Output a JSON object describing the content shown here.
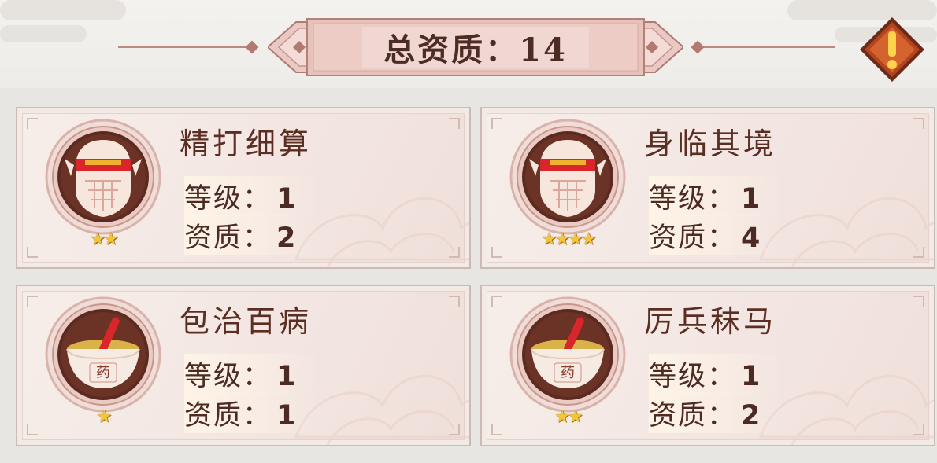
{
  "header": {
    "title": "总资质：14",
    "warning_icon": "exclamation-icon"
  },
  "colors": {
    "title_text": "#4e2c26",
    "card_bg": "#f3e6e2",
    "medallion_ring": "#5a2a20",
    "star": "#f2c53b",
    "accent_red": "#d8262a"
  },
  "skills": [
    {
      "name": "精打细算",
      "level_label": "等级：",
      "level": "1",
      "quality_label": "资质：",
      "quality": "2",
      "stars": "★★",
      "icon": "masked-face-icon"
    },
    {
      "name": "身临其境",
      "level_label": "等级：",
      "level": "1",
      "quality_label": "资质：",
      "quality": "4",
      "stars": "★★★★",
      "icon": "masked-face-icon"
    },
    {
      "name": "包治百病",
      "level_label": "等级：",
      "level": "1",
      "quality_label": "资质：",
      "quality": "1",
      "stars": "★",
      "icon": "medicine-bowl-icon",
      "bowl_text": "药"
    },
    {
      "name": "厉兵秣马",
      "level_label": "等级：",
      "level": "1",
      "quality_label": "资质：",
      "quality": "2",
      "stars": "★★",
      "icon": "medicine-bowl-icon",
      "bowl_text": "药"
    }
  ]
}
